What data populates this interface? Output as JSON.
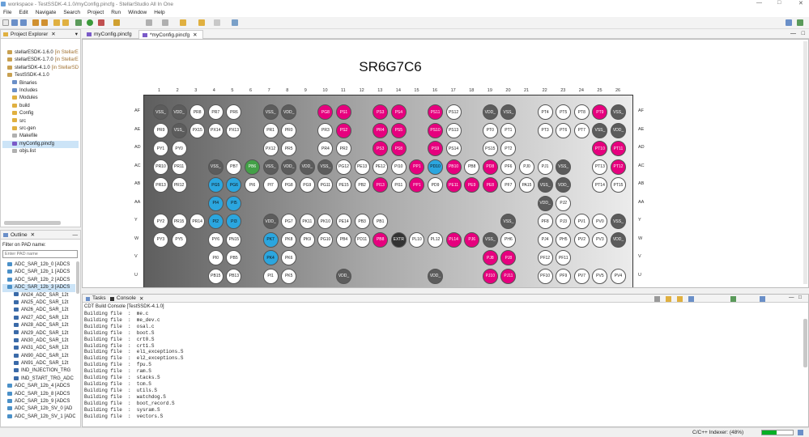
{
  "window": {
    "title": "workspace - TestSSDK-4.1.0/myConfig.pincfg - StellarStudio All In One"
  },
  "menu": [
    "File",
    "Edit",
    "Navigate",
    "Search",
    "Project",
    "Run",
    "Window",
    "Help"
  ],
  "project_explorer": {
    "tab_label": "Project Explorer",
    "items": [
      {
        "label": "stellarESDK-1.6.0",
        "suffix": "[in StellarESI",
        "color": "#c8a050"
      },
      {
        "label": "stellarESDK-1.7.0",
        "suffix": "[in StellarESI",
        "color": "#c8a050"
      },
      {
        "label": "stellarSDK-4.1.0",
        "suffix": "[in StellarSDK",
        "color": "#c8a050"
      },
      {
        "label": "TestSSDK-4.1.0",
        "suffix": "",
        "color": "#c8a050"
      },
      {
        "label": "Binaries",
        "suffix": "",
        "color": "#6a8fc8"
      },
      {
        "label": "Includes",
        "suffix": "",
        "color": "#6a8fc8"
      },
      {
        "label": "Modules",
        "suffix": "",
        "color": "#e0b040"
      },
      {
        "label": "build",
        "suffix": "",
        "color": "#e0b040"
      },
      {
        "label": "Config",
        "suffix": "",
        "color": "#e0b040"
      },
      {
        "label": "src",
        "suffix": "",
        "color": "#e0b040"
      },
      {
        "label": "src-gen",
        "suffix": "",
        "color": "#e0b040"
      },
      {
        "label": "Makefile",
        "suffix": "",
        "color": "#b0b0b0"
      },
      {
        "label": "myConfig.pincfg",
        "suffix": "",
        "color": "#7a5ac8"
      },
      {
        "label": "objs.list",
        "suffix": "",
        "color": "#b0b0b0"
      }
    ]
  },
  "outline": {
    "tab_label": "Outline",
    "filter_label": "Filter on PAD name:",
    "filter_placeholder": "Enter PAD name",
    "items": [
      "ADC_SAR_12b_0 [ADCS",
      "ADC_SAR_12b_1 [ADCS",
      "ADC_SAR_12b_2 [ADCS",
      "ADC_SAR_12b_3 [ADCS",
      "AN24_ADC_SAR_12t",
      "AN25_ADC_SAR_12t",
      "AN26_ADC_SAR_12t",
      "AN27_ADC_SAR_12t",
      "AN28_ADC_SAR_12t",
      "AN29_ADC_SAR_12t",
      "AN30_ADC_SAR_12t",
      "AN31_ADC_SAR_12t",
      "AN90_ADC_SAR_12t",
      "AN91_ADC_SAR_12t",
      "IND_INJECTION_TRG",
      "IND_START_TRG_ADC",
      "ADC_SAR_12b_4 [ADCS",
      "ADC_SAR_12b_8 [ADCS",
      "ADC_SAR_12b_9 [ADCS",
      "ADC_SAR_12b_SV_0 [AD",
      "ADC_SAR_12b_SV_1 [ADCS"
    ]
  },
  "editor": {
    "tabs": [
      "myConfig.pincfg",
      "*myConfig.pincfg"
    ],
    "chip_title": "SR6G7C6",
    "columns": [
      "1",
      "2",
      "3",
      "4",
      "5",
      "6",
      "7",
      "8",
      "9",
      "10",
      "11",
      "12",
      "13",
      "14",
      "15",
      "16",
      "17",
      "18",
      "19",
      "20",
      "21",
      "22",
      "23",
      "24",
      "25",
      "26"
    ],
    "row_labels": [
      "AF",
      "AE",
      "AD",
      "AC",
      "AB",
      "AA",
      "Y",
      "W",
      "V",
      "U"
    ],
    "pins": [
      [
        "VSS_",
        "VDD_",
        "PR8",
        "PR7",
        "PR6",
        "",
        "VSS_",
        "VDD_",
        "",
        "PG8",
        "PS1",
        "",
        "PS3",
        "PS4",
        "",
        "PS11",
        "PS12",
        "",
        "VDD_",
        "VSS_",
        "",
        "PT4",
        "PT5",
        "PT8",
        "PT9",
        "VSS_"
      ],
      [
        "PR9",
        "VSS_",
        "PX15",
        "PX14",
        "PX13",
        "",
        "PR1",
        "PR0",
        "",
        "PR3",
        "PS2",
        "",
        "PR4",
        "PS5",
        "",
        "PS10",
        "PS13",
        "",
        "PT0",
        "PT1",
        "",
        "PT3",
        "PT6",
        "PT7",
        "VSS_",
        "VDD_"
      ],
      [
        "PY1",
        "PY0",
        "",
        "",
        "",
        "",
        "PX12",
        "PR5",
        "",
        "PR4",
        "PR2",
        "",
        "PS3",
        "PS8",
        "",
        "PS9",
        "PS14",
        "",
        "PS15",
        "PT2",
        "",
        "",
        "",
        "",
        "PT10",
        "PT11"
      ],
      [
        "PR10",
        "PR11",
        "",
        "VSS_",
        "PB7",
        "PB6",
        "VSS_",
        "VDD_",
        "VDD_",
        "VSS_",
        "PG12",
        "PE13",
        "PE12",
        "PI10",
        "PP1",
        "PD10",
        "PB10",
        "PB8",
        "PD8",
        "PF6",
        "PJ0",
        "PJ1",
        "VSS_",
        "",
        "PT13",
        "PT12"
      ],
      [
        "PR13",
        "PR12",
        "",
        "PG5",
        "PG6",
        "PI6",
        "PI7",
        "PG8",
        "PG9",
        "PG11",
        "PE15",
        "PB2",
        "PI13",
        "PI11",
        "PP1",
        "PD9",
        "PE11",
        "PE9",
        "PE8",
        "PF7",
        "PA15",
        "VSS_",
        "VDD_",
        "",
        "PT14",
        "PT15"
      ],
      [
        "",
        "",
        "",
        "PI4",
        "PI5",
        "",
        "",
        "",
        "",
        "",
        "",
        "",
        "",
        "",
        "",
        "",
        "",
        "",
        "",
        "",
        "",
        "VDD_",
        "PJ2",
        "",
        "",
        ""
      ],
      [
        "PY2",
        "PR15",
        "PR14",
        "PI2",
        "PI3",
        "",
        "VDD_",
        "PG7",
        "PK11",
        "PK10",
        "PE14",
        "PB3",
        "PB1",
        "",
        "",
        "",
        "",
        "",
        "",
        "VSS_",
        "",
        "PF8",
        "PJ3",
        "PV1",
        "PV0",
        "VSS_"
      ],
      [
        "PY3",
        "PY5",
        "",
        "PY6",
        "PN15",
        "",
        "PK7",
        "PK8",
        "PK9",
        "PG10",
        "PB4",
        "PD11",
        "PB8",
        "EXTR",
        "PL10",
        "PL12",
        "PL14",
        "PJ6",
        "VSS_",
        "PH6",
        "",
        "PJ4",
        "PH5",
        "PV2",
        "PV3",
        "VDD_"
      ],
      [
        "",
        "",
        "",
        "PI0",
        "PB5",
        "",
        "PK4",
        "PK6",
        "",
        "",
        "",
        "",
        "",
        "",
        "",
        "",
        "",
        "",
        "PJ8",
        "PJ8",
        "",
        "PF12",
        "PF11",
        "",
        "",
        ""
      ],
      [
        "",
        "",
        "",
        "PB15",
        "PB13",
        "",
        "PI1",
        "PK5",
        "",
        "",
        "VDD_",
        "",
        "",
        "",
        "",
        "VDD_",
        "",
        "",
        "PJ10",
        "PJ11",
        "",
        "PF10",
        "PF9",
        "PV7",
        "PV5",
        "PV4"
      ]
    ],
    "pin_colors": [
      "GGwwwnGGnMMnMMnMwnGGnwwwMG",
      "wGwwwnwwnwMnMMnMwnwwnwwwGG",
      "wwnnnnwwnwwnMMnMwnwwnnnnMM",
      "wwnGwNGGGGwwwwMBMwMwwwGnwM",
      "wwnBBwwwwwwwMwMwMMMwwGGnww",
      "nnnBBnnnnnnnnnnnnnnnnGwnnn",
      "wwwBBnGwwwwwwnnnnnnGnwwwwG",
      "wwnwwnBwwwwwMKwwMMGwnwwwwG",
      "nnnwwnBwnnnnnnnnnnMMnwwnnn",
      "nnnwwnwwnnGnnnnGnnMMnwwwww"
    ]
  },
  "console": {
    "tabs": [
      "Tasks",
      "Console"
    ],
    "header": "CDT Build Console [TestSSDK-4.1.0]",
    "lines": [
      "Building file  :  me.c",
      "Building file  :  me_dev.c",
      "Building file  :  osal.c",
      "Building file  :  boot.S",
      "Building file  :  crt0.S",
      "Building file  :  crt1.S",
      "Building file  :  el1_exceptions.S",
      "Building file  :  el2_exceptions.S",
      "Building file  :  fpu.S",
      "Building file  :  ram.S",
      "Building file  :  stacks.S",
      "Building file  :  tcm.S",
      "Building file  :  utils.S",
      "Building file  :  watchdog.S",
      "Building file  :  boot_record.S",
      "Building file  :  sysram.S",
      "Building file  :  vectors.S"
    ]
  },
  "status": {
    "indexer": "C/C++ Indexer: (48%)",
    "indexer_progress": 0.48
  }
}
